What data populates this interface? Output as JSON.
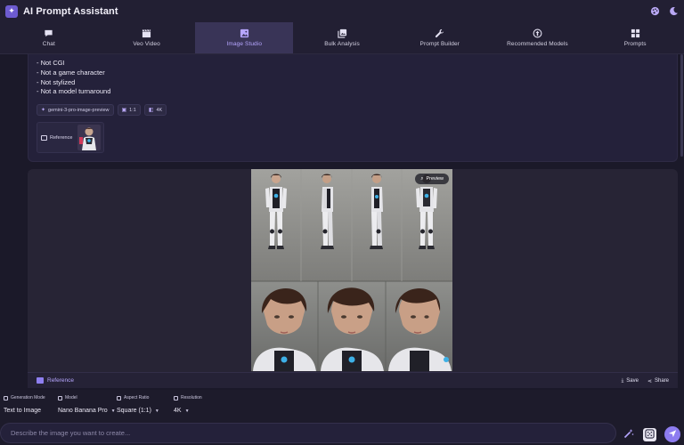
{
  "app": {
    "title": "AI Prompt Assistant"
  },
  "header_icons": [
    "palette-icon",
    "moon-icon"
  ],
  "tabs": [
    {
      "label": "Chat",
      "icon": "chat-icon"
    },
    {
      "label": "Veo Video",
      "icon": "clapper-icon"
    },
    {
      "label": "Image Studio",
      "icon": "image-icon",
      "active": true
    },
    {
      "label": "Bulk Analysis",
      "icon": "images-icon"
    },
    {
      "label": "Prompt Builder",
      "icon": "wrench-icon"
    },
    {
      "label": "Recommended Models",
      "icon": "upload-circle-icon"
    },
    {
      "label": "Prompts",
      "icon": "grid-icon"
    }
  ],
  "prompt_card": {
    "lines": [
      "- Not CGI",
      "- Not a game character",
      "- Not stylized",
      "- Not a model turnaround"
    ],
    "chips": {
      "model": "gemini-3-pro-image-preview",
      "aspect": "1:1",
      "resolution": "4K"
    },
    "reference_label": "Reference"
  },
  "result": {
    "preview_label": "Preview",
    "reference_label": "Reference",
    "save_label": "Save",
    "share_label": "Share"
  },
  "controls": {
    "labels": {
      "mode": "Generation Mode",
      "model": "Model",
      "aspect": "Aspect Ratio",
      "resolution": "Resolution"
    },
    "values": {
      "mode": "Text to Image",
      "model": "Nano Banana Pro",
      "aspect": "Square (1:1)",
      "resolution": "4K"
    },
    "input_placeholder": "Describe the image you want to create..."
  },
  "colors": {
    "accent": "#8d7cf0",
    "active_tab_bg": "#393457",
    "background": "#1b1929"
  }
}
